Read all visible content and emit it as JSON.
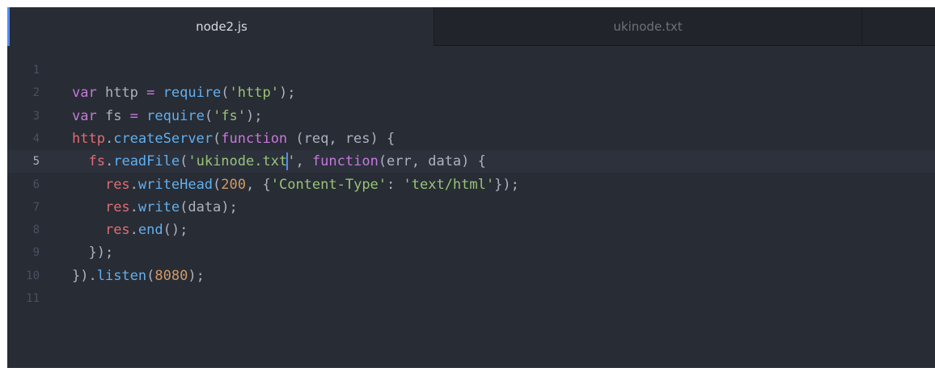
{
  "tabs": [
    {
      "label": "node2.js",
      "active": true
    },
    {
      "label": "ukinode.txt",
      "active": false
    }
  ],
  "editor": {
    "cursor": {
      "line": 5,
      "column": 26
    },
    "lines": [
      {
        "number": "1",
        "tokens": []
      },
      {
        "number": "2",
        "tokens": [
          {
            "t": "var",
            "c": "kw"
          },
          {
            "t": " http ",
            "c": "pl"
          },
          {
            "t": "=",
            "c": "kw"
          },
          {
            "t": " ",
            "c": "pl"
          },
          {
            "t": "require",
            "c": "fn"
          },
          {
            "t": "(",
            "c": "pl"
          },
          {
            "t": "'http'",
            "c": "str"
          },
          {
            "t": ");",
            "c": "pl"
          }
        ]
      },
      {
        "number": "3",
        "tokens": [
          {
            "t": "var",
            "c": "kw"
          },
          {
            "t": " fs ",
            "c": "pl"
          },
          {
            "t": "=",
            "c": "kw"
          },
          {
            "t": " ",
            "c": "pl"
          },
          {
            "t": "require",
            "c": "fn"
          },
          {
            "t": "(",
            "c": "pl"
          },
          {
            "t": "'fs'",
            "c": "str"
          },
          {
            "t": ");",
            "c": "pl"
          }
        ]
      },
      {
        "number": "4",
        "tokens": [
          {
            "t": "http",
            "c": "var"
          },
          {
            "t": ".",
            "c": "pl"
          },
          {
            "t": "createServer",
            "c": "fn"
          },
          {
            "t": "(",
            "c": "pl"
          },
          {
            "t": "function",
            "c": "kw"
          },
          {
            "t": " (req, res) {",
            "c": "pl"
          }
        ]
      },
      {
        "number": "5",
        "tokens": [
          {
            "t": "  ",
            "c": "pl"
          },
          {
            "t": "fs",
            "c": "var"
          },
          {
            "t": ".",
            "c": "pl"
          },
          {
            "t": "readFile",
            "c": "fn"
          },
          {
            "t": "(",
            "c": "pl"
          },
          {
            "t": "'ukinode.txt",
            "c": "str"
          },
          {
            "t": "|caret|",
            "c": "caret"
          },
          {
            "t": "'",
            "c": "str"
          },
          {
            "t": ", ",
            "c": "pl"
          },
          {
            "t": "function",
            "c": "kw"
          },
          {
            "t": "(err, data) {",
            "c": "pl"
          }
        ]
      },
      {
        "number": "6",
        "tokens": [
          {
            "t": "    ",
            "c": "pl"
          },
          {
            "t": "res",
            "c": "var"
          },
          {
            "t": ".",
            "c": "pl"
          },
          {
            "t": "writeHead",
            "c": "fn"
          },
          {
            "t": "(",
            "c": "pl"
          },
          {
            "t": "200",
            "c": "num"
          },
          {
            "t": ", {",
            "c": "pl"
          },
          {
            "t": "'Content-Type'",
            "c": "str"
          },
          {
            "t": ": ",
            "c": "pl"
          },
          {
            "t": "'text/html'",
            "c": "str"
          },
          {
            "t": "});",
            "c": "pl"
          }
        ]
      },
      {
        "number": "7",
        "tokens": [
          {
            "t": "    ",
            "c": "pl"
          },
          {
            "t": "res",
            "c": "var"
          },
          {
            "t": ".",
            "c": "pl"
          },
          {
            "t": "write",
            "c": "fn"
          },
          {
            "t": "(data);",
            "c": "pl"
          }
        ]
      },
      {
        "number": "8",
        "tokens": [
          {
            "t": "    ",
            "c": "pl"
          },
          {
            "t": "res",
            "c": "var"
          },
          {
            "t": ".",
            "c": "pl"
          },
          {
            "t": "end",
            "c": "fn"
          },
          {
            "t": "();",
            "c": "pl"
          }
        ]
      },
      {
        "number": "9",
        "tokens": [
          {
            "t": "  });",
            "c": "pl"
          }
        ]
      },
      {
        "number": "10",
        "tokens": [
          {
            "t": "}).",
            "c": "pl"
          },
          {
            "t": "listen",
            "c": "fn"
          },
          {
            "t": "(",
            "c": "pl"
          },
          {
            "t": "8080",
            "c": "num"
          },
          {
            "t": ");",
            "c": "pl"
          }
        ]
      },
      {
        "number": "11",
        "tokens": []
      }
    ]
  }
}
